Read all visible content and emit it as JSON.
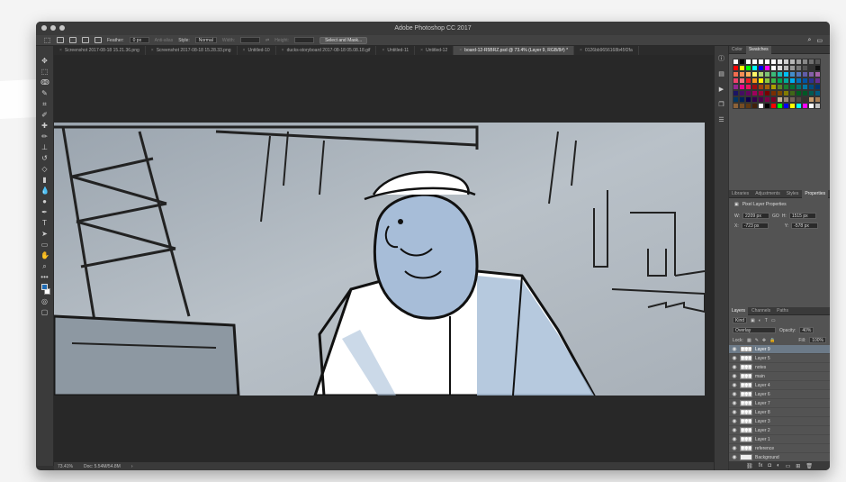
{
  "app": {
    "title": "Adobe Photoshop CC 2017"
  },
  "options_bar": {
    "feather_label": "Feather:",
    "feather_value": "0 px",
    "antialias_label": "Anti-alias",
    "style_label": "Style:",
    "style_value": "Normal",
    "width_label": "Width:",
    "height_label": "Height:",
    "select_mask_label": "Select and Mask..."
  },
  "doc_tabs": [
    {
      "label": "Screenshot 2017-08-18 15.21.36.png",
      "active": false
    },
    {
      "label": "Screenshot 2017-08-18 15.28.33.png",
      "active": false
    },
    {
      "label": "Untitled-10",
      "active": false
    },
    {
      "label": "ducks-storyboard 2017-08-18 05.08.18.gif",
      "active": false
    },
    {
      "label": "Untitled-11",
      "active": false
    },
    {
      "label": "Untitled-12",
      "active": false
    },
    {
      "label": "board-12-R5BRZ.psd @ 73.4% (Layer 9, RGB/8#) *",
      "active": true
    },
    {
      "label": "0126bb9656168b45f2fa",
      "active": false
    }
  ],
  "status_bar": {
    "zoom": "73.41%",
    "doc_info": "Doc: 5.54M/54.8M"
  },
  "colors": {
    "foreground": "#1f6bb4",
    "background": "#ffffff",
    "selected_layer_bg": "#6c7a88"
  },
  "color_panel": {
    "tabs": [
      "Color",
      "Swatches"
    ],
    "active_tab": "Swatches",
    "swatches": [
      "#ffffff",
      "#000000",
      "#ffffff",
      "#ffffff",
      "#ffffff",
      "#ffffff",
      "#ffffff",
      "#e8e8e8",
      "#d0d0d0",
      "#b8b8b8",
      "#a0a0a0",
      "#888888",
      "#707070",
      "#585858",
      "#ff0000",
      "#ffff00",
      "#00ff00",
      "#00ffff",
      "#0000ff",
      "#ff00ff",
      "#ffffff",
      "#dddddd",
      "#bbbbbb",
      "#999999",
      "#777777",
      "#555555",
      "#333333",
      "#111111",
      "#f26c4f",
      "#f68e55",
      "#fbaf5c",
      "#fff467",
      "#acd372",
      "#7dc473",
      "#3cb878",
      "#1abbb4",
      "#00bff3",
      "#438cca",
      "#5574b9",
      "#605ca8",
      "#855fa8",
      "#a763a8",
      "#f0426c",
      "#f26d7d",
      "#ed1c24",
      "#f7941d",
      "#fff200",
      "#8dc63f",
      "#39b54a",
      "#00a651",
      "#00a99d",
      "#00aeef",
      "#0072bc",
      "#0054a6",
      "#2e3192",
      "#662d91",
      "#92278f",
      "#ec008c",
      "#ed145b",
      "#9e0b0f",
      "#a0410d",
      "#a36209",
      "#aba000",
      "#598527",
      "#1a7b30",
      "#007236",
      "#00746b",
      "#0076a3",
      "#004b80",
      "#003471",
      "#1b1464",
      "#440e62",
      "#630460",
      "#9e005d",
      "#9e0039",
      "#790000",
      "#7b2e00",
      "#7d4900",
      "#827b00",
      "#406618",
      "#005e20",
      "#005826",
      "#005952",
      "#005b7f",
      "#003663",
      "#002157",
      "#0d004c",
      "#32004b",
      "#4b0049",
      "#7b0046",
      "#7a0026",
      "#c7b299",
      "#998675",
      "#736357",
      "#534741",
      "#37302d",
      "#c69c6d",
      "#a67c52",
      "#8c6239",
      "#754c24",
      "#603913",
      "#42210b",
      "#ffffff",
      "#000000",
      "#ff0000",
      "#00ff00",
      "#0000ff",
      "#ffff00",
      "#00ffff",
      "#ff00ff",
      "#ffffff",
      "#c0c0c0"
    ]
  },
  "properties_panel": {
    "tabs": [
      "Libraries",
      "Adjustments",
      "Styles",
      "Properties"
    ],
    "active_tab": "Properties",
    "title": "Pixel Layer Properties",
    "w_label": "W:",
    "w_value": "2209 px",
    "link_label": "GO",
    "h_label": "H:",
    "h_value": "1515 px",
    "x_label": "X:",
    "x_value": "-723 px",
    "y_label": "Y:",
    "y_value": "-578 px"
  },
  "layers_panel": {
    "tabs": [
      "Layers",
      "Channels",
      "Paths"
    ],
    "active_tab": "Layers",
    "filter_value": "Kind",
    "blend_mode": "Overlay",
    "opacity_label": "Opacity:",
    "opacity_value": "40%",
    "lock_label": "Lock:",
    "fill_label": "Fill:",
    "fill_value": "100%",
    "layers": [
      {
        "name": "Layer 9",
        "selected": true
      },
      {
        "name": "Layer 5",
        "selected": false
      },
      {
        "name": "notes",
        "selected": false
      },
      {
        "name": "main",
        "selected": false
      },
      {
        "name": "Layer 4",
        "selected": false
      },
      {
        "name": "Layer 6",
        "selected": false
      },
      {
        "name": "Layer 7",
        "selected": false
      },
      {
        "name": "Layer 8",
        "selected": false
      },
      {
        "name": "Layer 3",
        "selected": false
      },
      {
        "name": "Layer 2",
        "selected": false
      },
      {
        "name": "Layer 1",
        "selected": false
      },
      {
        "name": "reference",
        "selected": false
      },
      {
        "name": "Background",
        "selected": false
      }
    ]
  },
  "tool_icons": [
    "move-icon",
    "marquee-icon",
    "lasso-icon",
    "quick-select-icon",
    "crop-icon",
    "eyedropper-icon",
    "healing-icon",
    "brush-icon",
    "stamp-icon",
    "history-brush-icon",
    "eraser-icon",
    "gradient-icon",
    "blur-icon",
    "dodge-icon",
    "pen-icon",
    "type-icon",
    "path-select-icon",
    "shape-icon",
    "hand-icon",
    "zoom-icon",
    "more-icon"
  ]
}
